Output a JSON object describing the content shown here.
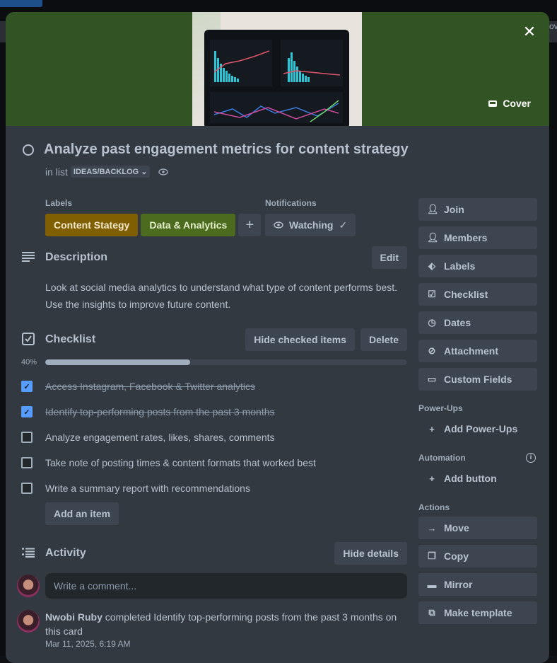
{
  "backdrop": {
    "right_edge_text": "ov"
  },
  "cover": {
    "button_label": "Cover"
  },
  "card": {
    "title": "Analyze past engagement metrics for content strategy",
    "in_list_prefix": "in list",
    "list_name": "IDEAS/BACKLOG"
  },
  "labels": {
    "heading": "Labels",
    "items": [
      {
        "text": "Content Stategy",
        "color": "#7f5f01"
      },
      {
        "text": "Data & Analytics",
        "color": "#4c6b1f"
      }
    ],
    "add_symbol": "+"
  },
  "notifications": {
    "heading": "Notifications",
    "button_label": "Watching"
  },
  "description": {
    "heading": "Description",
    "edit_label": "Edit",
    "text": "Look at social media analytics to understand what type of content performs best. Use the insights to improve future content."
  },
  "checklist": {
    "heading": "Checklist",
    "hide_checked_label": "Hide checked items",
    "delete_label": "Delete",
    "progress_label": "40%",
    "progress_value": 0.4,
    "items": [
      {
        "text": "Access Instagram, Facebook & Twitter analytics",
        "checked": true
      },
      {
        "text": "Identify top-performing posts from the past 3 months",
        "checked": true
      },
      {
        "text": "Analyze engagement rates, likes, shares, comments",
        "checked": false
      },
      {
        "text": "Take note of posting times & content formats that worked best",
        "checked": false
      },
      {
        "text": "Write a summary report with recommendations",
        "checked": false
      }
    ],
    "add_item_label": "Add an item"
  },
  "activity": {
    "heading": "Activity",
    "hide_details_label": "Hide details",
    "comment_placeholder": "Write a comment...",
    "entry": {
      "user": "Nwobi Ruby",
      "action": " completed Identify top-performing posts from the past 3 months on this card",
      "timestamp": "Mar 11, 2025, 6:19 AM"
    }
  },
  "sidebar": {
    "card_actions": [
      {
        "label": "Join",
        "icon": "person-icon"
      },
      {
        "label": "Members",
        "icon": "person-icon"
      },
      {
        "label": "Labels",
        "icon": "tag-icon"
      },
      {
        "label": "Checklist",
        "icon": "checkbox-icon"
      },
      {
        "label": "Dates",
        "icon": "clock-icon"
      },
      {
        "label": "Attachment",
        "icon": "paperclip-icon"
      },
      {
        "label": "Custom Fields",
        "icon": "fields-icon"
      }
    ],
    "powerups_heading": "Power-Ups",
    "add_powerups_label": "Add Power-Ups",
    "automation_heading": "Automation",
    "add_button_label": "Add button",
    "actions_heading": "Actions",
    "actions": [
      {
        "label": "Move",
        "icon": "arrow-right-icon"
      },
      {
        "label": "Copy",
        "icon": "copy-icon"
      },
      {
        "label": "Mirror",
        "icon": "mirror-icon"
      },
      {
        "label": "Make template",
        "icon": "template-icon"
      }
    ]
  }
}
